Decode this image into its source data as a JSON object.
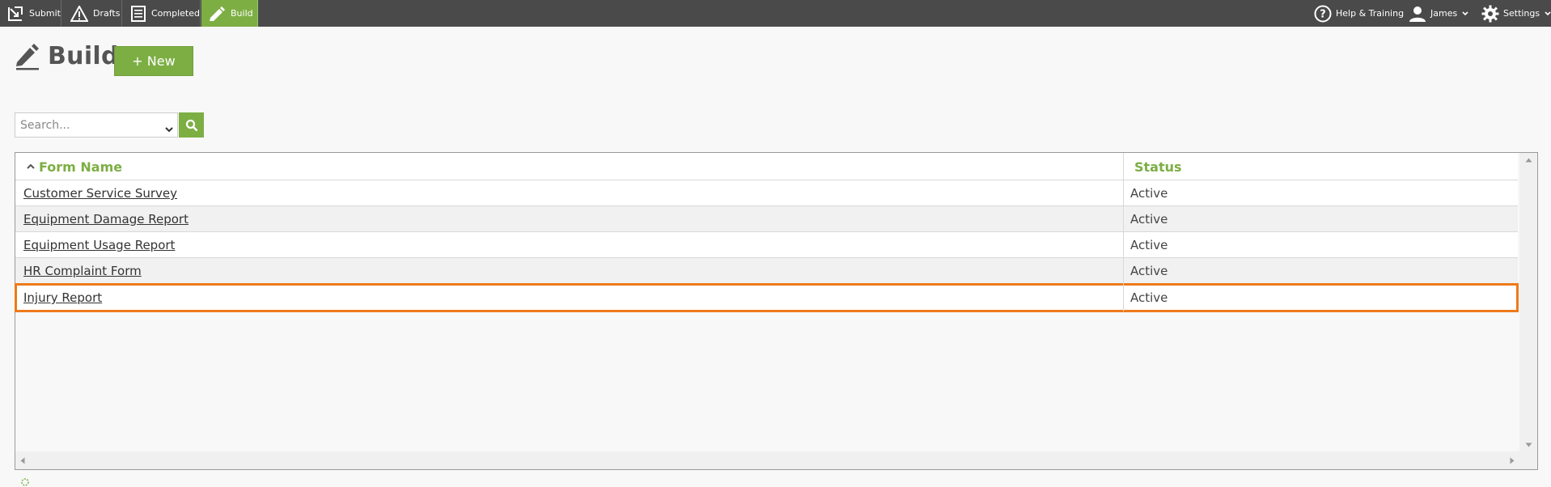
{
  "nav": {
    "tabs": [
      {
        "label": "Submit",
        "icon": "submit-icon"
      },
      {
        "label": "Drafts",
        "icon": "warning-icon"
      },
      {
        "label": "Completed",
        "icon": "document-icon"
      },
      {
        "label": "Build",
        "icon": "pencil-icon"
      }
    ],
    "active_tab": "Build",
    "help_label": "Help & Training",
    "user_label": "James",
    "settings_label": "Settings"
  },
  "page": {
    "title": "Build",
    "new_button_label": "+ New"
  },
  "search": {
    "placeholder": "Search..."
  },
  "table": {
    "columns": [
      {
        "label": "Form Name",
        "sort": "ascending"
      },
      {
        "label": "Status"
      }
    ],
    "rows": [
      {
        "name": "Customer Service Survey",
        "status": "Active"
      },
      {
        "name": "Equipment Damage Report",
        "status": "Active"
      },
      {
        "name": "Equipment Usage Report",
        "status": "Active"
      },
      {
        "name": "HR Complaint Form",
        "status": "Active"
      },
      {
        "name": "Injury Report",
        "status": "Active",
        "selected": true
      }
    ]
  },
  "colors": {
    "topbar": "#4a4a4a",
    "accent": "#7dae44",
    "selection_outline": "#ee7a1b"
  }
}
